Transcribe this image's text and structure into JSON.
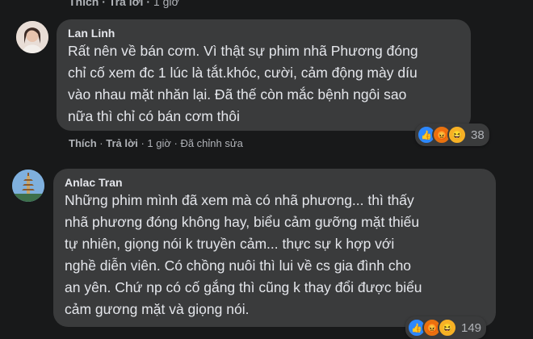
{
  "top_actions": {
    "like": "Thích",
    "reply": "Trả lời",
    "time": "1 giờ"
  },
  "comments": [
    {
      "author": "Lan Linh",
      "text": "Rất nên về bán cơm. Vì thật sự phim nhã Phương đóng\nchỉ cố xem đc 1 lúc là tắt.khóc, cười, cảm động mày díu\nvào nhau mặt nhăn lại. Đã thế còn mắc bệnh ngôi sao\nnữa thì chỉ có bán cơm thôi",
      "reaction_count": "38",
      "actions": {
        "like": "Thích",
        "reply": "Trả lời",
        "time": "1 giờ",
        "edited": "Đã chỉnh sửa"
      }
    },
    {
      "author": "Anlac Tran",
      "text": "Những phim mình đã xem mà có nhã phương... thì thấy\nnhã phương đóng không hay, biểu cảm gưỡng mặt thiếu\ntự nhiên, giọng nói k truyền cảm... thực sự k hợp với\nnghề diễn viên. Có chồng nuôi thì lui về cs gia đình cho\nan yên. Chứ np có cố gắng thì cũng k thay đổi được biểu\ncảm gương mặt và giọng nói.",
      "reaction_count": "149"
    }
  ],
  "colors": {
    "background": "#18191a",
    "bubble": "#3a3b3c",
    "text": "#e4e6eb",
    "secondary_text": "#b0b3b8",
    "like_blue": "#2d88ff"
  },
  "reaction_icons": [
    "like-icon",
    "angry-icon",
    "haha-icon"
  ]
}
